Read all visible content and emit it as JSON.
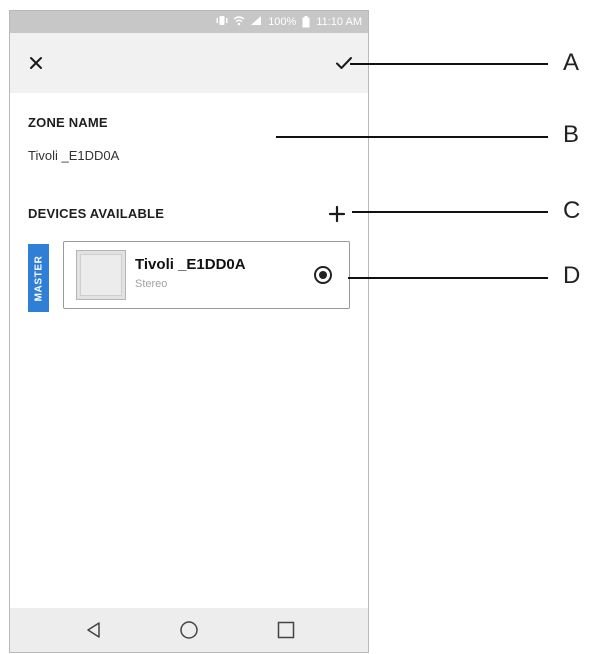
{
  "status_bar": {
    "battery": "100%",
    "time": "11:10 AM",
    "icons": [
      "vibrate-icon",
      "wifi-icon",
      "signal-icon",
      "battery-icon"
    ]
  },
  "top_bar": {
    "close_icon": "close-icon",
    "confirm_icon": "check-icon"
  },
  "zone": {
    "label": "ZONE NAME",
    "value": "Tivoli _E1DD0A"
  },
  "devices": {
    "label": "DEVICES AVAILABLE",
    "add_icon": "plus-icon",
    "items": [
      {
        "role_tag": "MASTER",
        "name": "Tivoli _E1DD0A",
        "mode": "Stereo",
        "selected": true
      }
    ]
  },
  "nav_bar": {
    "icons": [
      "back-icon",
      "home-icon",
      "recents-icon"
    ]
  },
  "callouts": [
    "A",
    "B",
    "C",
    "D"
  ],
  "colors": {
    "status_bar": "#c7c7c7",
    "top_bar": "#f1f1f1",
    "master_tag": "#2f7fd6",
    "nav_bar": "#ededed"
  }
}
